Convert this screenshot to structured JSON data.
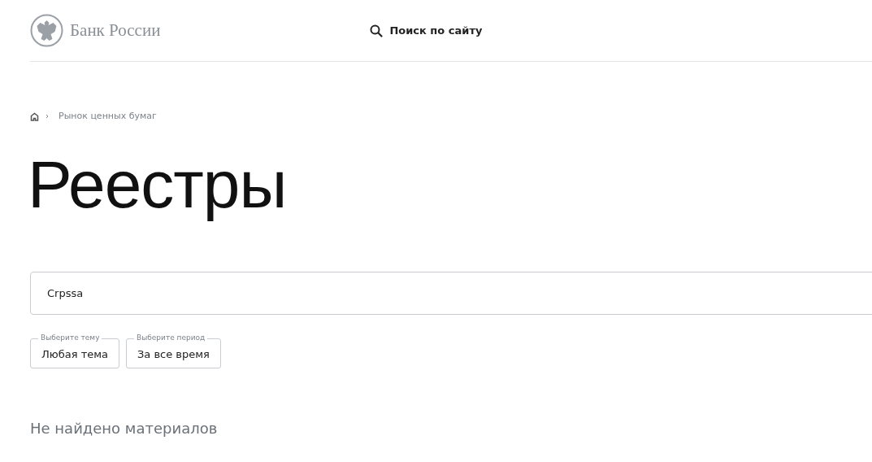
{
  "header": {
    "brand": "Банк России",
    "search_label": "Поиск по сайту"
  },
  "breadcrumb": {
    "items": [
      "Рынок ценных бумаг"
    ]
  },
  "title": "Реестры",
  "search": {
    "value": "Crpssa"
  },
  "filters": [
    {
      "legend": "Выберите тему",
      "value": "Любая тема"
    },
    {
      "legend": "Выберите период",
      "value": "За все время"
    }
  ],
  "empty_message": "Не найдено материалов"
}
